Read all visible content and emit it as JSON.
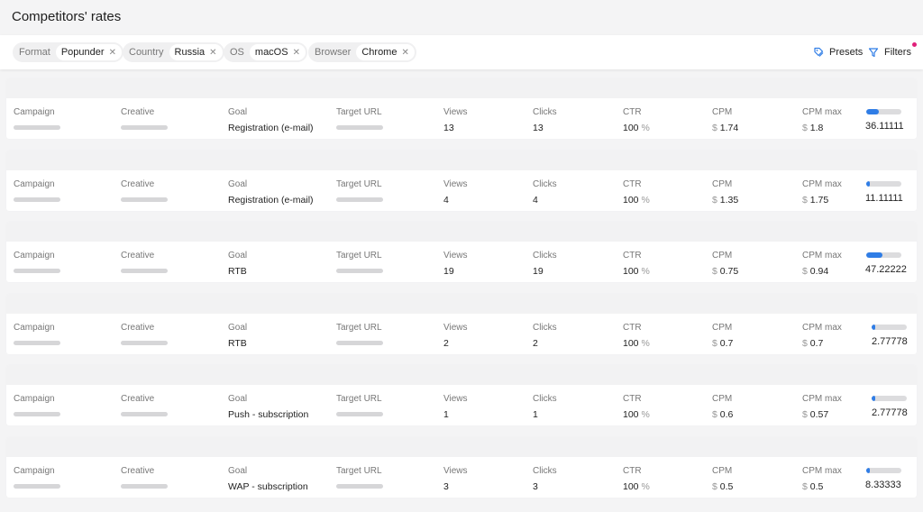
{
  "page": {
    "title": "Competitors' rates"
  },
  "filters": [
    {
      "key": "Format",
      "value": "Popunder"
    },
    {
      "key": "Country",
      "value": "Russia"
    },
    {
      "key": "OS",
      "value": "macOS"
    },
    {
      "key": "Browser",
      "value": "Chrome"
    }
  ],
  "toolbar": {
    "presets_label": "Presets",
    "filters_label": "Filters",
    "accent": "#2f7de6",
    "dot_color": "#e0207a"
  },
  "labels": {
    "campaign": "Campaign",
    "creative": "Creative",
    "goal": "Goal",
    "target_url": "Target URL",
    "views": "Views",
    "clicks": "Clicks",
    "ctr": "CTR",
    "cpm": "CPM",
    "cpm_max": "CPM max",
    "currency": "$",
    "percent": "%"
  },
  "rows": [
    {
      "goal": "Registration (e-mail)",
      "views": "13",
      "clicks": "13",
      "ctr": "100",
      "cpm": "1.74",
      "cpm_max": "1.8",
      "score": "36.11111",
      "score_fraction": 0.36
    },
    {
      "goal": "Registration (e-mail)",
      "views": "4",
      "clicks": "4",
      "ctr": "100",
      "cpm": "1.35",
      "cpm_max": "1.75",
      "score": "11.11111",
      "score_fraction": 0.11
    },
    {
      "goal": "RTB",
      "views": "19",
      "clicks": "19",
      "ctr": "100",
      "cpm": "0.75",
      "cpm_max": "0.94",
      "score": "47.22222",
      "score_fraction": 0.47
    },
    {
      "goal": "RTB",
      "views": "2",
      "clicks": "2",
      "ctr": "100",
      "cpm": "0.7",
      "cpm_max": "0.7",
      "score": "2.77778",
      "score_fraction": 0.03
    },
    {
      "goal": "Push - subscription",
      "views": "1",
      "clicks": "1",
      "ctr": "100",
      "cpm": "0.6",
      "cpm_max": "0.57",
      "score": "2.77778",
      "score_fraction": 0.03
    },
    {
      "goal": "WAP - subscription",
      "views": "3",
      "clicks": "3",
      "ctr": "100",
      "cpm": "0.5",
      "cpm_max": "0.5",
      "score": "8.33333",
      "score_fraction": 0.08
    }
  ]
}
